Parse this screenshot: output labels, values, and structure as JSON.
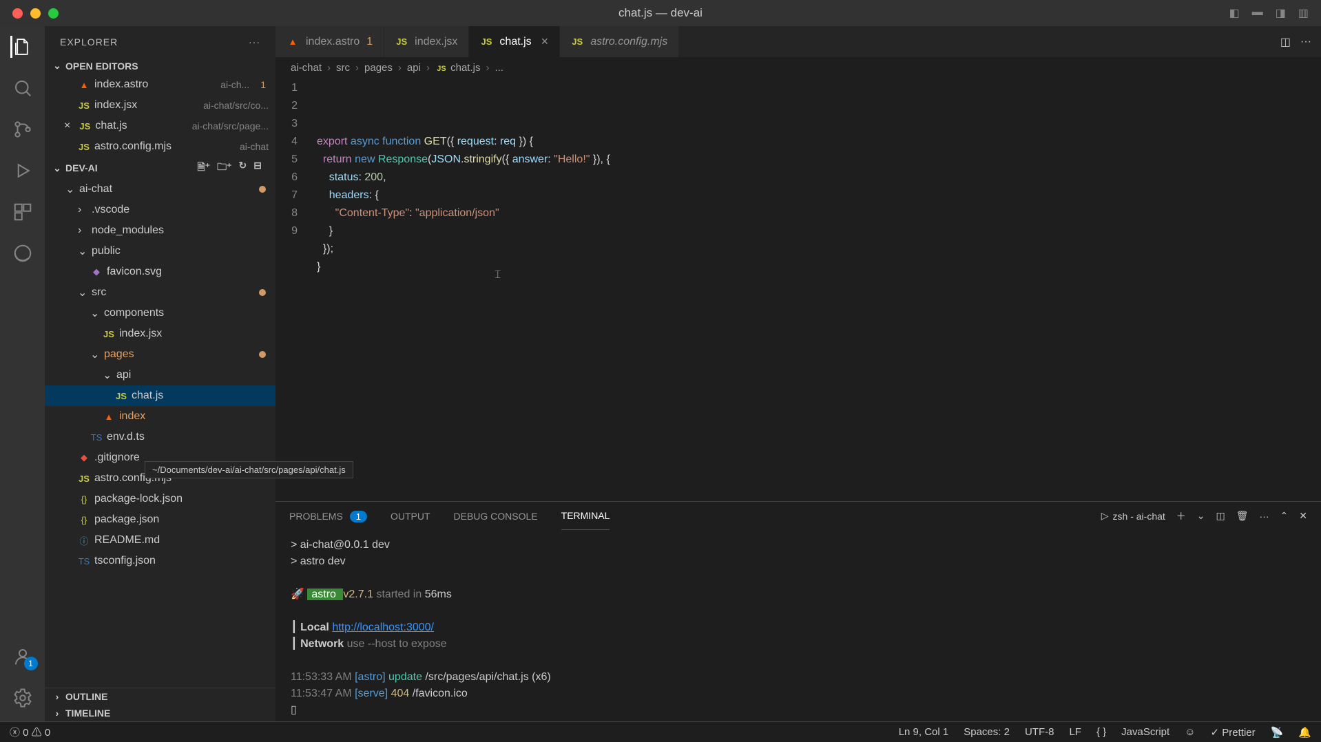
{
  "window": {
    "title": "chat.js — dev-ai"
  },
  "sidebar": {
    "title": "EXPLORER",
    "openEditors": {
      "label": "OPEN EDITORS",
      "items": [
        {
          "name": "index.astro",
          "meta": "ai-ch...",
          "mod": "1",
          "icon": "astro"
        },
        {
          "name": "index.jsx",
          "meta": "ai-chat/src/co...",
          "icon": "js"
        },
        {
          "name": "chat.js",
          "meta": "ai-chat/src/page...",
          "icon": "js",
          "active": true
        },
        {
          "name": "astro.config.mjs",
          "meta": "ai-chat",
          "icon": "js"
        }
      ]
    },
    "workspace": {
      "label": "DEV-AI",
      "tree": [
        {
          "name": "ai-chat",
          "depth": 1,
          "type": "folder",
          "open": true,
          "dirty": true
        },
        {
          "name": ".vscode",
          "depth": 2,
          "type": "folder"
        },
        {
          "name": "node_modules",
          "depth": 2,
          "type": "folder"
        },
        {
          "name": "public",
          "depth": 2,
          "type": "folder",
          "open": true
        },
        {
          "name": "favicon.svg",
          "depth": 3,
          "type": "file",
          "icon": "svg"
        },
        {
          "name": "src",
          "depth": 2,
          "type": "folder",
          "open": true,
          "dirty": true
        },
        {
          "name": "components",
          "depth": 3,
          "type": "folder",
          "open": true
        },
        {
          "name": "index.jsx",
          "depth": 4,
          "type": "file",
          "icon": "js"
        },
        {
          "name": "pages",
          "depth": 3,
          "type": "folder",
          "open": true,
          "dirty": true,
          "orange": true
        },
        {
          "name": "api",
          "depth": 4,
          "type": "folder",
          "open": true
        },
        {
          "name": "chat.js",
          "depth": 5,
          "type": "file",
          "icon": "js",
          "active": true
        },
        {
          "name": "index",
          "depth": 4,
          "type": "file",
          "icon": "astro",
          "orange": true
        },
        {
          "name": "env.d.ts",
          "depth": 3,
          "type": "file",
          "icon": "ts"
        },
        {
          "name": ".gitignore",
          "depth": 2,
          "type": "file",
          "icon": "git"
        },
        {
          "name": "astro.config.mjs",
          "depth": 2,
          "type": "file",
          "icon": "js"
        },
        {
          "name": "package-lock.json",
          "depth": 2,
          "type": "file",
          "icon": "json"
        },
        {
          "name": "package.json",
          "depth": 2,
          "type": "file",
          "icon": "json"
        },
        {
          "name": "README.md",
          "depth": 2,
          "type": "file",
          "icon": "md"
        },
        {
          "name": "tsconfig.json",
          "depth": 2,
          "type": "file",
          "icon": "ts"
        }
      ]
    },
    "outline": "OUTLINE",
    "timeline": "TIMELINE",
    "tooltip": "~/Documents/dev-ai/ai-chat/src/pages/api/chat.js"
  },
  "tabs": [
    {
      "label": "index.astro",
      "icon": "astro",
      "mod": "1"
    },
    {
      "label": "index.jsx",
      "icon": "js"
    },
    {
      "label": "chat.js",
      "icon": "js",
      "active": true,
      "close": "×"
    },
    {
      "label": "astro.config.mjs",
      "icon": "js",
      "italic": true
    }
  ],
  "breadcrumb": [
    "ai-chat",
    "src",
    "pages",
    "api",
    "chat.js",
    "..."
  ],
  "code": {
    "lines": [
      "export async function GET({ request: req }) {",
      "  return new Response(JSON.stringify({ answer: \"Hello!\" }), {",
      "    status: 200,",
      "    headers: {",
      "      \"Content-Type\": \"application/json\"",
      "    }",
      "  });",
      "}",
      ""
    ]
  },
  "panel": {
    "tabs": {
      "problems": "PROBLEMS",
      "problemsBadge": "1",
      "output": "OUTPUT",
      "debug": "DEBUG CONSOLE",
      "terminal": "TERMINAL"
    },
    "termLabel": "zsh - ai-chat",
    "terminal": {
      "l1": "> ai-chat@0.0.1 dev",
      "l2": "> astro dev",
      "rocket": "🚀",
      "astro_badge": " astro ",
      "ver": "v2.7.1",
      "started": "started in",
      "ms": "56ms",
      "local_lbl": "Local",
      "local_url": "http://localhost:3000/",
      "net_lbl": "Network",
      "net_hint": "use --host to expose",
      "t1": "11:53:33 AM",
      "t2": "11:53:47 AM",
      "tag1": "[astro]",
      "tag2": "[serve]",
      "upd": "update",
      "upd_path": "/src/pages/api/chat.js (x6)",
      "code404": "404",
      "path404": "/favicon.ico"
    }
  },
  "status": {
    "errors": "0",
    "warnings": "0",
    "ln": "Ln 9, Col 1",
    "spaces": "Spaces: 2",
    "enc": "UTF-8",
    "eol": "LF",
    "lang": "JavaScript",
    "prettier": "Prettier"
  }
}
